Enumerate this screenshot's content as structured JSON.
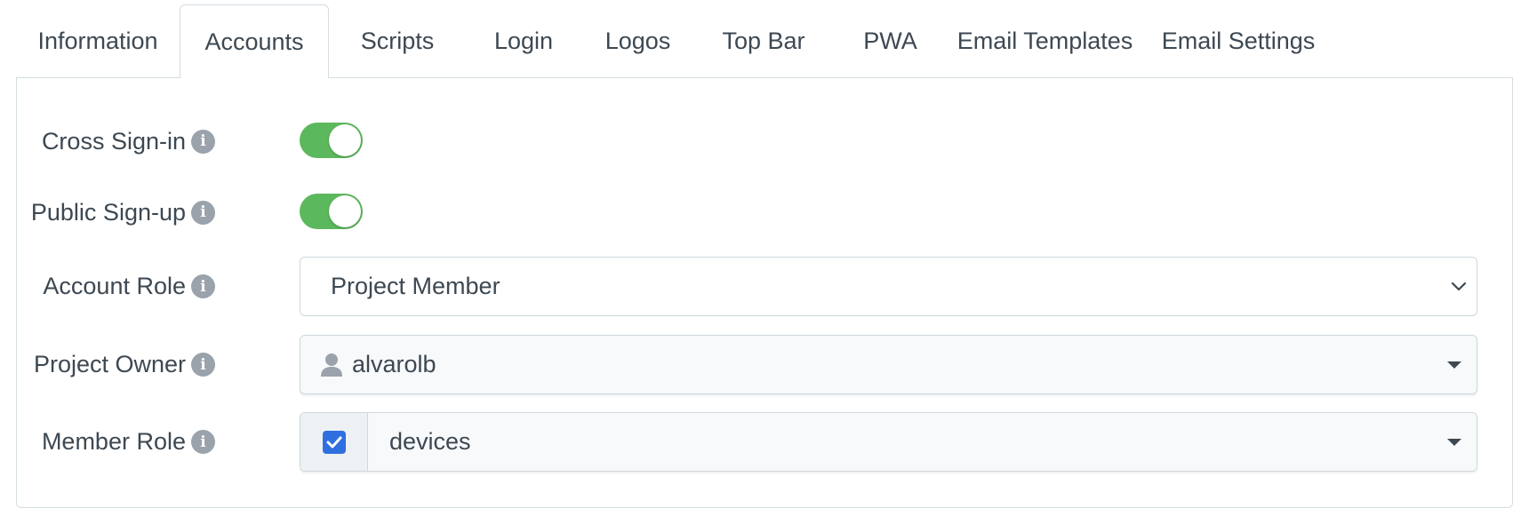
{
  "tabs": [
    {
      "label": "Information",
      "active": false
    },
    {
      "label": "Accounts",
      "active": true
    },
    {
      "label": "Scripts",
      "active": false
    },
    {
      "label": "Login",
      "active": false
    },
    {
      "label": "Logos",
      "active": false
    },
    {
      "label": "Top Bar",
      "active": false
    },
    {
      "label": "PWA",
      "active": false
    },
    {
      "label": "Email Templates",
      "active": false
    },
    {
      "label": "Email Settings",
      "active": false
    }
  ],
  "form": {
    "cross_signin": {
      "label": "Cross Sign-in",
      "enabled": true
    },
    "public_signup": {
      "label": "Public Sign-up",
      "enabled": true
    },
    "account_role": {
      "label": "Account Role",
      "value": "Project Member"
    },
    "project_owner": {
      "label": "Project Owner",
      "value": "alvarolb",
      "icon": "user-icon"
    },
    "member_role": {
      "label": "Member Role",
      "value": "devices",
      "checked": true
    }
  },
  "info_icon_glyph": "i",
  "colors": {
    "toggle_on": "#5cb85c",
    "checkbox": "#2f6fe0",
    "border": "#d5dde2",
    "text": "#3d4852"
  }
}
